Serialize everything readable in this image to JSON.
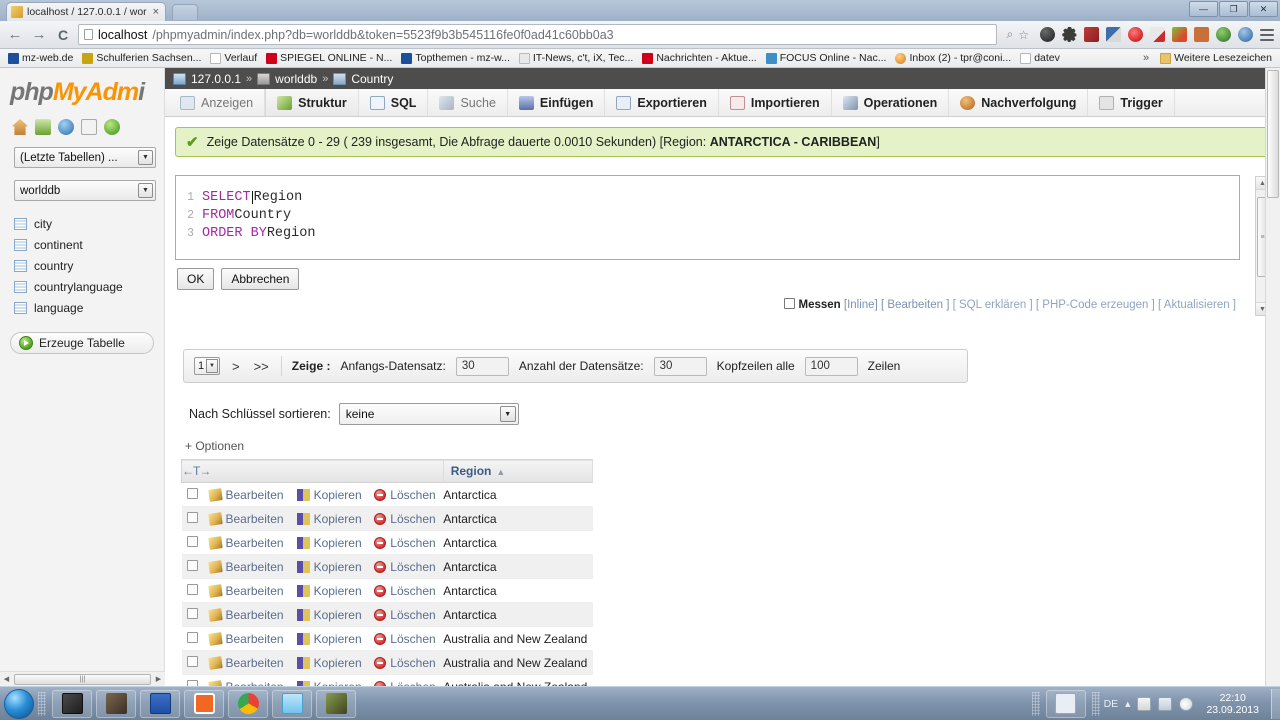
{
  "browser": {
    "tab": {
      "title": "localhost / 127.0.0.1 / wor",
      "close": "×",
      "favicon_name": "phpmyadmin-favicon"
    },
    "window_controls": {
      "minimize": "—",
      "restore": "❐",
      "close": "✕"
    },
    "nav": {
      "back": "←",
      "forward": "→",
      "reload": "C"
    },
    "omnibox": {
      "url_host": "localhost",
      "url_rest": "/phpmyadmin/index.php?db=worlddb&token=5523f9b3b545116fe0f0ad41c60bb0a3",
      "search_icon": "⌕",
      "star_icon": "☆"
    },
    "menu_icon": "hamburger-menu-icon",
    "bookmarks": [
      {
        "label": "mz-web.de",
        "color": "#1c4f9c"
      },
      {
        "label": "Schulferien Sachsen...",
        "color": "#c8a415"
      },
      {
        "label": "Verlauf",
        "color": "#ffffff"
      },
      {
        "label": "SPIEGEL ONLINE - N...",
        "color": "#d0021b"
      },
      {
        "label": "Topthemen - mz-w...",
        "color": "#1c4f9c"
      },
      {
        "label": "IT-News, c't, iX, Tec...",
        "color": "#e8e8e8"
      },
      {
        "label": "Nachrichten - Aktue...",
        "color": "#d0021b"
      },
      {
        "label": "FOCUS Online - Nac...",
        "color": "#3f8fc7"
      },
      {
        "label": "Inbox (2) - tpr@coni...",
        "color": "#f0a030"
      },
      {
        "label": "datev",
        "color": "#ffffff"
      }
    ],
    "bookmarks_overflow": "»",
    "other_bookmarks": {
      "label": "Weitere Lesezeichen",
      "color": "#e8c46a"
    }
  },
  "pma": {
    "logo": {
      "part1": "php",
      "part2": "MyAdm",
      "part3": "i"
    },
    "navi_icons": [
      "home-icon",
      "logout-icon",
      "docs-icon",
      "wiki-icon",
      "reload-icon"
    ],
    "recent_tables_select": "(Letzte Tabellen) ...",
    "database_select": "worlddb",
    "tables": [
      "city",
      "continent",
      "country",
      "countrylanguage",
      "language"
    ],
    "create_table_label": "Erzeuge Tabelle",
    "breadcrumb": {
      "server": "127.0.0.1",
      "database": "worlddb",
      "table": "Country",
      "separator": "»"
    },
    "tabs": [
      {
        "label": "Anzeigen",
        "icon": "browse-icon",
        "state": "disabled"
      },
      {
        "label": "Struktur",
        "icon": "structure-icon",
        "state": "active"
      },
      {
        "label": "SQL",
        "icon": "sql-icon",
        "state": "normal"
      },
      {
        "label": "Suche",
        "icon": "search-icon",
        "state": "disabled"
      },
      {
        "label": "Einfügen",
        "icon": "insert-icon",
        "state": "normal"
      },
      {
        "label": "Exportieren",
        "icon": "export-icon",
        "state": "normal"
      },
      {
        "label": "Importieren",
        "icon": "import-icon",
        "state": "normal"
      },
      {
        "label": "Operationen",
        "icon": "operations-icon",
        "state": "normal"
      },
      {
        "label": "Nachverfolgung",
        "icon": "tracking-icon",
        "state": "normal"
      },
      {
        "label": "Trigger",
        "icon": "trigger-icon",
        "state": "normal"
      }
    ],
    "notice": {
      "check_icon": "✔",
      "text": "Zeige Datensätze 0 - 29 ( 239 insgesamt, Die Abfrage dauerte 0.0010 Sekunden) [Region: ",
      "bold": "ANTARCTICA - CARIBBEAN",
      "suffix": "]"
    },
    "sql_editor": {
      "lines": [
        {
          "n": "1",
          "kw": "SELECT",
          "rest": " Region"
        },
        {
          "n": "2",
          "kw": "FROM",
          "rest": " Country"
        },
        {
          "n": "3",
          "kw": "ORDER BY",
          "rest": " Region"
        }
      ],
      "ok_label": "OK",
      "cancel_label": "Abbrechen"
    },
    "sql_options": {
      "measure_label": "Messen",
      "inline": "[Inline]",
      "edit": "[ Bearbeiten ]",
      "explain": "[ SQL erklären ]",
      "php": "[ PHP-Code erzeugen ]",
      "refresh": "[ Aktualisieren ]"
    },
    "pager": {
      "page": "1",
      "next": ">",
      "last": ">>",
      "show_label": "Zeige :",
      "start_label": "Anfangs-Datensatz:",
      "start_value": "30",
      "count_label": "Anzahl der Datensätze:",
      "count_value": "30",
      "headers_label": "Kopfzeilen alle",
      "headers_value": "100",
      "rows_label": "Zeilen"
    },
    "sort": {
      "label": "Nach Schlüssel sortieren:",
      "value": "keine"
    },
    "options_link": "+ Optionen",
    "results": {
      "move_icons": "←T→",
      "column_header": "Region",
      "sort_indicator": "▲",
      "actions": {
        "edit": "Bearbeiten",
        "copy": "Kopieren",
        "delete": "Löschen"
      },
      "rows": [
        {
          "region": "Antarctica"
        },
        {
          "region": "Antarctica"
        },
        {
          "region": "Antarctica"
        },
        {
          "region": "Antarctica"
        },
        {
          "region": "Antarctica"
        },
        {
          "region": "Antarctica"
        },
        {
          "region": "Australia and New Zealand"
        },
        {
          "region": "Australia and New Zealand"
        },
        {
          "region": "Australia and New Zealand"
        }
      ]
    }
  },
  "taskbar": {
    "start_label": "start-orb",
    "items": [
      {
        "name": "sublime-text",
        "color": "#3a3a3a"
      },
      {
        "name": "file-explorer",
        "color": "#5a4a38"
      },
      {
        "name": "save-floppy-app",
        "color": "#1f4fa8"
      },
      {
        "name": "xampp-control-panel",
        "color": "#f26722"
      },
      {
        "name": "google-chrome",
        "color": "#4285f4"
      },
      {
        "name": "notepad-editor",
        "color": "#6fc4ef"
      },
      {
        "name": "camtasia-recorder",
        "color": "#5d6a2e"
      }
    ],
    "tray": {
      "pen-tablet-icon": "pen-tablet-icon",
      "language": "DE",
      "show_hidden": "▴",
      "action_center_icon": "action-center-icon",
      "network_icon": "network-icon",
      "volume_icon": "volume-icon",
      "time": "22:10",
      "date": "23.09.2013"
    }
  }
}
